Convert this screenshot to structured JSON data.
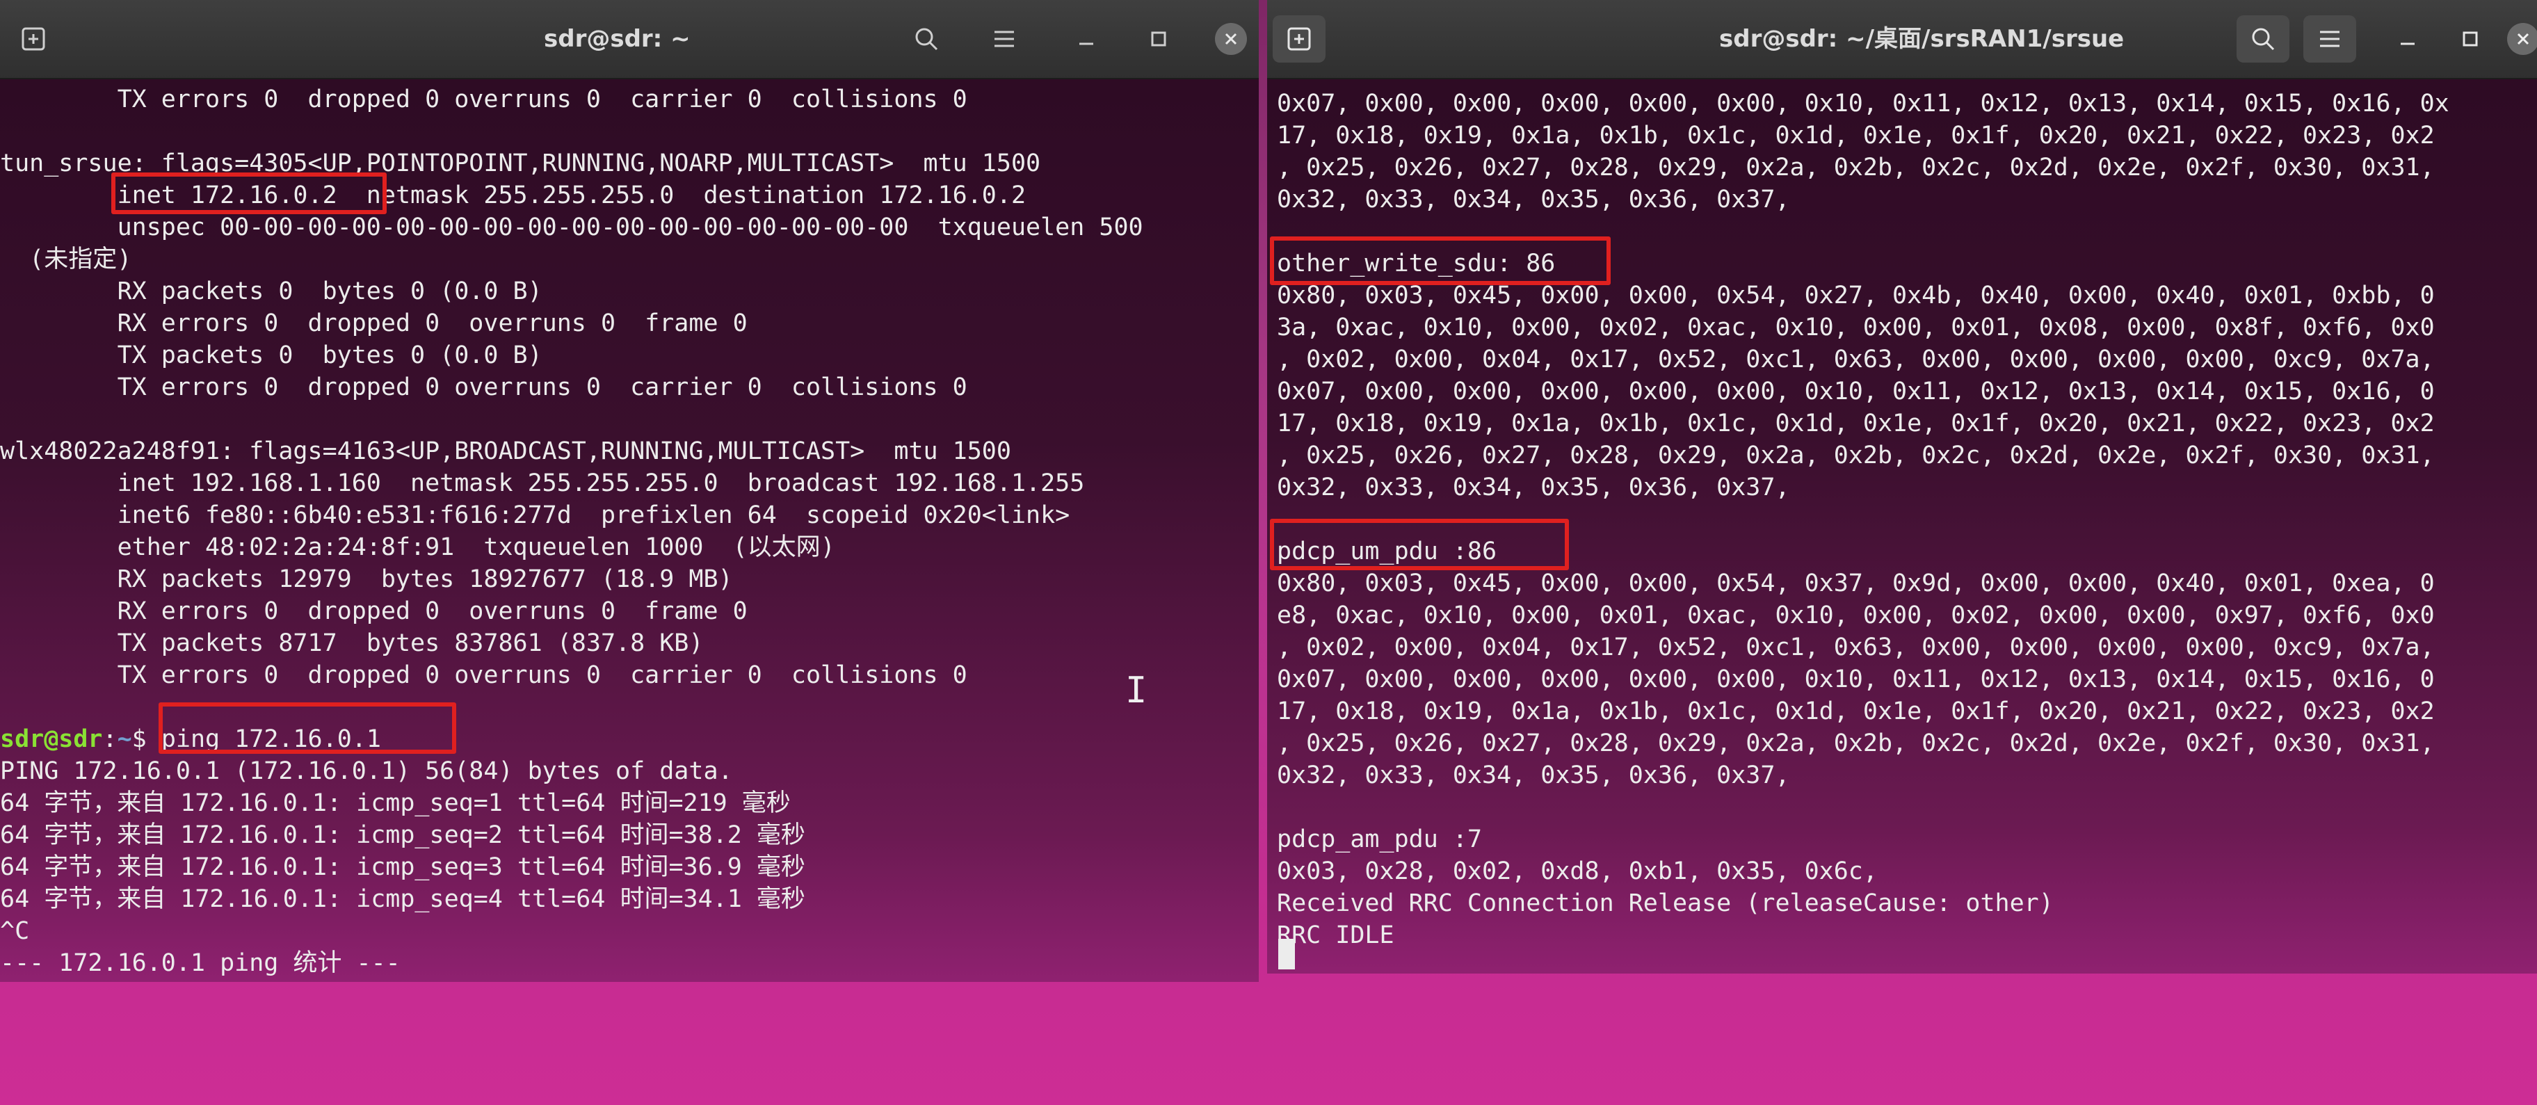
{
  "left_window": {
    "title": "sdr@sdr: ~",
    "lines": [
      "        TX errors 0  dropped 0 overruns 0  carrier 0  collisions 0",
      "",
      "tun_srsue: flags=4305<UP,POINTOPOINT,RUNNING,NOARP,MULTICAST>  mtu 1500",
      "        inet 172.16.0.2  netmask 255.255.255.0  destination 172.16.0.2",
      "        unspec 00-00-00-00-00-00-00-00-00-00-00-00-00-00-00-00  txqueuelen 500",
      "  (未指定)",
      "        RX packets 0  bytes 0 (0.0 B)",
      "        RX errors 0  dropped 0  overruns 0  frame 0",
      "        TX packets 0  bytes 0 (0.0 B)",
      "        TX errors 0  dropped 0 overruns 0  carrier 0  collisions 0",
      "",
      "wlx48022a248f91: flags=4163<UP,BROADCAST,RUNNING,MULTICAST>  mtu 1500",
      "        inet 192.168.1.160  netmask 255.255.255.0  broadcast 192.168.1.255",
      "        inet6 fe80::6b40:e531:f616:277d  prefixlen 64  scopeid 0x20<link>",
      "        ether 48:02:2a:24:8f:91  txqueuelen 1000  (以太网)",
      "        RX packets 12979  bytes 18927677 (18.9 MB)",
      "        RX errors 0  dropped 0  overruns 0  frame 0",
      "        TX packets 8717  bytes 837861 (837.8 KB)",
      "        TX errors 0  dropped 0 overruns 0  carrier 0  collisions 0",
      "",
      "",
      "PING 172.16.0.1 (172.16.0.1) 56(84) bytes of data.",
      "64 字节，来自 172.16.0.1: icmp_seq=1 ttl=64 时间=219 毫秒",
      "64 字节，来自 172.16.0.1: icmp_seq=2 ttl=64 时间=38.2 毫秒",
      "64 字节，来自 172.16.0.1: icmp_seq=3 ttl=64 时间=36.9 毫秒",
      "64 字节，来自 172.16.0.1: icmp_seq=4 ttl=64 时间=34.1 毫秒",
      "^C",
      "--- 172.16.0.1 ping 统计 ---"
    ],
    "prompt": {
      "user": "sdr@sdr",
      "sep": ":",
      "path": "~",
      "symbol": "$ ",
      "command": "ping 172.16.0.1"
    }
  },
  "right_window": {
    "title": "sdr@sdr: ~/桌面/srsRAN1/srsue",
    "lines": [
      "0x07, 0x00, 0x00, 0x00, 0x00, 0x00, 0x10, 0x11, 0x12, 0x13, 0x14, 0x15, 0x16, 0x",
      "17, 0x18, 0x19, 0x1a, 0x1b, 0x1c, 0x1d, 0x1e, 0x1f, 0x20, 0x21, 0x22, 0x23, 0x2",
      ", 0x25, 0x26, 0x27, 0x28, 0x29, 0x2a, 0x2b, 0x2c, 0x2d, 0x2e, 0x2f, 0x30, 0x31,",
      "0x32, 0x33, 0x34, 0x35, 0x36, 0x37,",
      "",
      "other_write_sdu: 86",
      "0x80, 0x03, 0x45, 0x00, 0x00, 0x54, 0x27, 0x4b, 0x40, 0x00, 0x40, 0x01, 0xbb, 0",
      "3a, 0xac, 0x10, 0x00, 0x02, 0xac, 0x10, 0x00, 0x01, 0x08, 0x00, 0x8f, 0xf6, 0x0",
      ", 0x02, 0x00, 0x04, 0x17, 0x52, 0xc1, 0x63, 0x00, 0x00, 0x00, 0x00, 0xc9, 0x7a,",
      "0x07, 0x00, 0x00, 0x00, 0x00, 0x00, 0x10, 0x11, 0x12, 0x13, 0x14, 0x15, 0x16, 0",
      "17, 0x18, 0x19, 0x1a, 0x1b, 0x1c, 0x1d, 0x1e, 0x1f, 0x20, 0x21, 0x22, 0x23, 0x2",
      ", 0x25, 0x26, 0x27, 0x28, 0x29, 0x2a, 0x2b, 0x2c, 0x2d, 0x2e, 0x2f, 0x30, 0x31,",
      "0x32, 0x33, 0x34, 0x35, 0x36, 0x37,",
      "",
      "pdcp_um_pdu :86",
      "0x80, 0x03, 0x45, 0x00, 0x00, 0x54, 0x37, 0x9d, 0x00, 0x00, 0x40, 0x01, 0xea, 0",
      "e8, 0xac, 0x10, 0x00, 0x01, 0xac, 0x10, 0x00, 0x02, 0x00, 0x00, 0x97, 0xf6, 0x0",
      ", 0x02, 0x00, 0x04, 0x17, 0x52, 0xc1, 0x63, 0x00, 0x00, 0x00, 0x00, 0xc9, 0x7a,",
      "0x07, 0x00, 0x00, 0x00, 0x00, 0x00, 0x10, 0x11, 0x12, 0x13, 0x14, 0x15, 0x16, 0",
      "17, 0x18, 0x19, 0x1a, 0x1b, 0x1c, 0x1d, 0x1e, 0x1f, 0x20, 0x21, 0x22, 0x23, 0x2",
      ", 0x25, 0x26, 0x27, 0x28, 0x29, 0x2a, 0x2b, 0x2c, 0x2d, 0x2e, 0x2f, 0x30, 0x31,",
      "0x32, 0x33, 0x34, 0x35, 0x36, 0x37,",
      "",
      "pdcp_am_pdu :7",
      "0x03, 0x28, 0x02, 0xd8, 0xb1, 0x35, 0x6c,",
      "Received RRC Connection Release (releaseCause: other)",
      "RRC IDLE"
    ]
  },
  "colors": {
    "highlight": "#e0201f",
    "prompt_user": "#8ae234",
    "prompt_path": "#729fcf",
    "terminal_text": "#ececec",
    "desktop": "#c92c93"
  },
  "icons": {
    "new_tab": "new-tab-icon",
    "search": "search-icon",
    "menu": "hamburger-menu-icon",
    "minimize": "minimize-icon",
    "maximize": "maximize-icon",
    "close": "close-icon"
  }
}
